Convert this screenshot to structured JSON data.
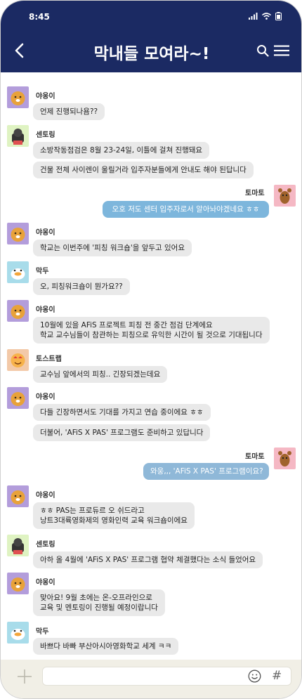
{
  "status": {
    "time": "8:45"
  },
  "header": {
    "title": "막내들 모여라~!"
  },
  "icons": {
    "back": "chevron-left-icon",
    "search": "search-icon",
    "menu": "hamburger-menu-icon",
    "add": "plus-icon",
    "emoji": "smiley-icon",
    "hashtag": "hash-icon"
  },
  "colors": {
    "header_bg": "#1b2a63",
    "my_bubble": "#7db6dc",
    "other_bubble": "#e9e9e9",
    "input_bar": "#f1efe6"
  },
  "messages": [
    {
      "sender": "야옹이",
      "lines": [
        "언제 진행되나욤??"
      ]
    },
    {
      "sender": "센토링",
      "lines": [
        "소방작동점검은 8월 23-24일, 이틀에 걸쳐 진행돼요",
        "건물 전체 사이렌이 울릴거라 입주자분들에게 안내도 해야 된답니다"
      ]
    },
    {
      "sender": "토마토",
      "mine": true,
      "lines": [
        "오호 저도 센터 입주자로서 알아놔야겠네요 ㅎㅎ"
      ]
    },
    {
      "sender": "야옹이",
      "lines": [
        "학교는 이번주에 '피칭 워크숍'을 앞두고 있어요"
      ]
    },
    {
      "sender": "막두",
      "lines": [
        "오, 피칭워크숍이 뭔가요??"
      ]
    },
    {
      "sender": "야옹이",
      "lines": [
        "10월에 있을 AFiS 프로젝트 피칭 전 중간 점검 단계에요",
        "학교 교수님들이 참관하는 피칭으로 유익한 시간이 될 것으로 기대됩니다"
      ]
    },
    {
      "sender": "토스트랩",
      "lines": [
        "교수님 앞에서의 피칭.. 긴장되겠는데요"
      ]
    },
    {
      "sender": "야옹이",
      "lines": [
        "다들 긴장하면서도 기대를 가지고 연습 중이에요 ㅎㅎ",
        "더불어, 'AFiS X PAS' 프로그램도 준비하고 있답니다"
      ]
    },
    {
      "sender": "토마토",
      "mine": true,
      "lines": [
        "와웅,,, 'AFiS X PAS' 프로그램이요?"
      ]
    },
    {
      "sender": "야옹이",
      "lines": [
        "ㅎㅎ PAS는 프로듀르 오 쉬드라고",
        "낭트3대륙영화제의 영화인력 교육 워크숍이에요"
      ]
    },
    {
      "sender": "센토링",
      "lines": [
        "아하 올 4월에 'AFiS X PAS' 프로그램 협약 체결했다는 소식 들었어요"
      ]
    },
    {
      "sender": "야옹이",
      "lines": [
        "맞아요! 9월 초에는 온-오프라인으로",
        "교육 및 멘토링이 진행될 예정이랍니다"
      ]
    },
    {
      "sender": "막두",
      "lines": [
        "바쁘다 바빠 부산아시아영화학교 세계 ㅋㅋ"
      ]
    }
  ]
}
